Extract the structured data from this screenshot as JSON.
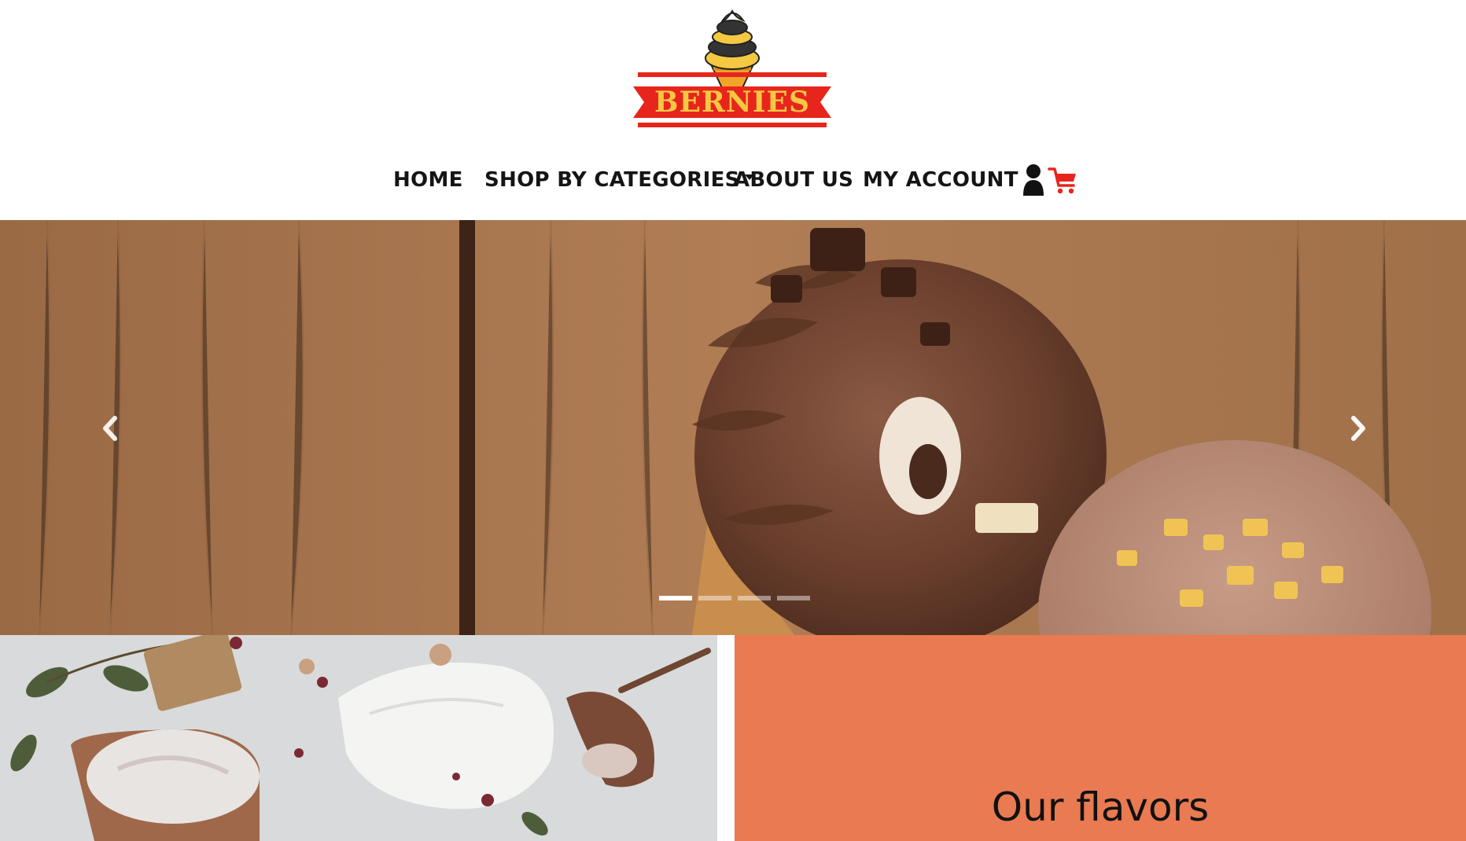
{
  "brand": {
    "name": "BERNIES"
  },
  "nav": {
    "home": "HOME",
    "shop": "SHOP BY CATEGORIES",
    "about": "ABOUT US",
    "account": "MY ACCOUNT"
  },
  "icons": {
    "account": "user-icon",
    "cart": "cart-icon",
    "prev": "chevron-left-icon",
    "next": "chevron-right-icon",
    "dropdown": "caret-down-icon"
  },
  "carousel": {
    "slide_count": 4,
    "active_index": 0
  },
  "sections": {
    "flavors_title": "Our flavors"
  },
  "colors": {
    "brand_red": "#e8251c",
    "logo_yellow": "#f5c842",
    "flavors_bg": "#e97a51",
    "nav_text": "#151515"
  }
}
